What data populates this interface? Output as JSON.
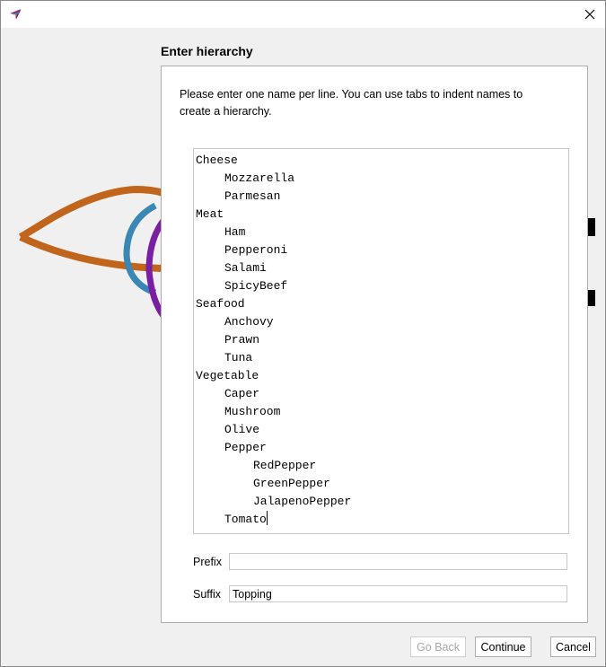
{
  "window": {
    "app_icon": "app-logo-icon",
    "close_icon": "close-icon"
  },
  "dialog": {
    "title": "Enter hierarchy",
    "instructions": "Please enter one name per line. You can use tabs to indent names to create a hierarchy.",
    "hierarchy_lines": [
      {
        "text": "Cheese",
        "level": 0
      },
      {
        "text": "Mozzarella",
        "level": 1
      },
      {
        "text": "Parmesan",
        "level": 1
      },
      {
        "text": "Meat",
        "level": 0
      },
      {
        "text": "Ham",
        "level": 1
      },
      {
        "text": "Pepperoni",
        "level": 1
      },
      {
        "text": "Salami",
        "level": 1
      },
      {
        "text": "SpicyBeef",
        "level": 1
      },
      {
        "text": "Seafood",
        "level": 0
      },
      {
        "text": "Anchovy",
        "level": 1
      },
      {
        "text": "Prawn",
        "level": 1
      },
      {
        "text": "Tuna",
        "level": 1
      },
      {
        "text": "Vegetable",
        "level": 0
      },
      {
        "text": "Caper",
        "level": 1
      },
      {
        "text": "Mushroom",
        "level": 1
      },
      {
        "text": "Olive",
        "level": 1
      },
      {
        "text": "Pepper",
        "level": 1
      },
      {
        "text": "RedPepper",
        "level": 2
      },
      {
        "text": "GreenPepper",
        "level": 2
      },
      {
        "text": "JalapenoPepper",
        "level": 2
      },
      {
        "text": "Tomato",
        "level": 1
      }
    ],
    "prefix_label": "Prefix",
    "prefix_value": "",
    "suffix_label": "Suffix",
    "suffix_value": "Topping"
  },
  "buttons": {
    "go_back": "Go Back",
    "continue": "Continue",
    "cancel": "Cancel"
  },
  "colors": {
    "logo_orange": "#c0651b",
    "logo_blue": "#3a87b5",
    "logo_purple": "#7b1fa2"
  }
}
